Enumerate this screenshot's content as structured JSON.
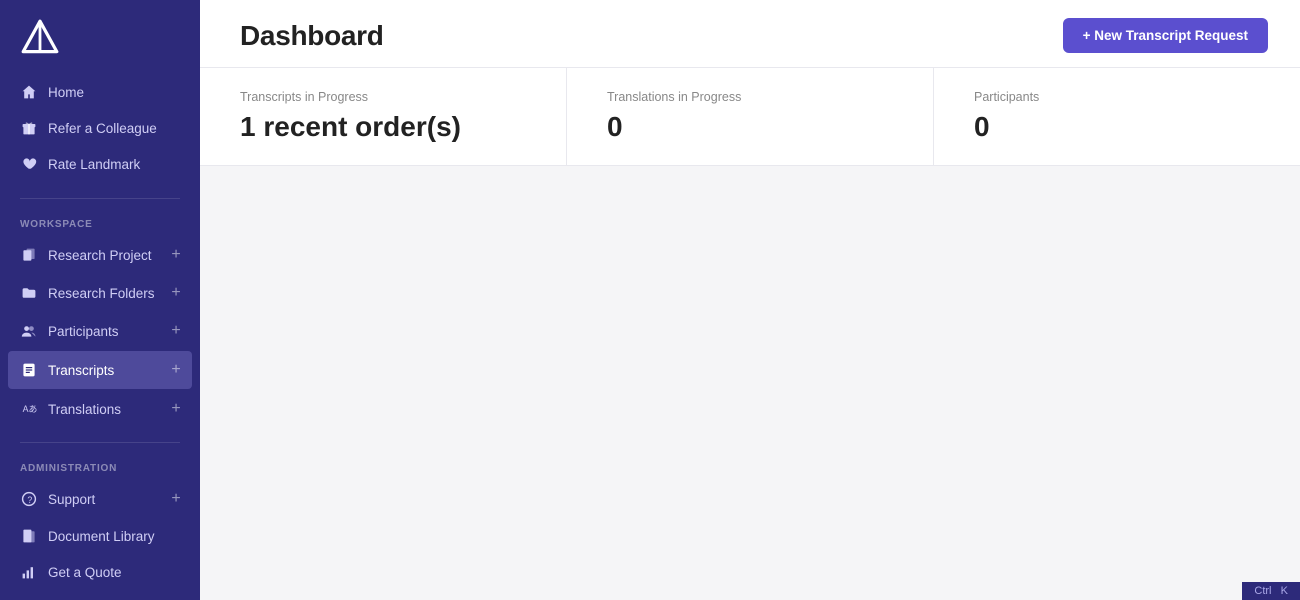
{
  "sidebar": {
    "logo_alt": "Landmark logo",
    "nav_top": [
      {
        "id": "home",
        "label": "Home",
        "icon": "home"
      },
      {
        "id": "refer",
        "label": "Refer a Colleague",
        "icon": "gift"
      },
      {
        "id": "rate",
        "label": "Rate Landmark",
        "icon": "heart"
      }
    ],
    "workspace_section": "WORKSPACE",
    "workspace_items": [
      {
        "id": "research-project",
        "label": "Research Project",
        "icon": "folder",
        "plus": true,
        "active": false
      },
      {
        "id": "research-folders",
        "label": "Research Folders",
        "icon": "folder2",
        "plus": true,
        "active": false
      },
      {
        "id": "participants",
        "label": "Participants",
        "icon": "people",
        "plus": true,
        "active": false
      },
      {
        "id": "transcripts",
        "label": "Transcripts",
        "icon": "edit",
        "plus": true,
        "active": true
      },
      {
        "id": "translations",
        "label": "Translations",
        "icon": "translate",
        "plus": true,
        "active": false
      }
    ],
    "admin_section": "ADMINISTRATION",
    "admin_items": [
      {
        "id": "support",
        "label": "Support",
        "icon": "question",
        "plus": true
      },
      {
        "id": "document-library",
        "label": "Document Library",
        "icon": "book",
        "plus": false
      },
      {
        "id": "get-a-quote",
        "label": "Get a Quote",
        "icon": "chart",
        "plus": false
      }
    ]
  },
  "header": {
    "title": "Dashboard",
    "new_request_label": "+ New Transcript Request"
  },
  "stats": [
    {
      "id": "transcripts-in-progress",
      "label": "Transcripts in Progress",
      "value": "1 recent order(s)"
    },
    {
      "id": "translations-in-progress",
      "label": "Translations in Progress",
      "value": "0"
    },
    {
      "id": "participants",
      "label": "Participants",
      "value": "0"
    }
  ],
  "bottom": {
    "kbd1": "Ctrl",
    "kbd2": "K"
  }
}
